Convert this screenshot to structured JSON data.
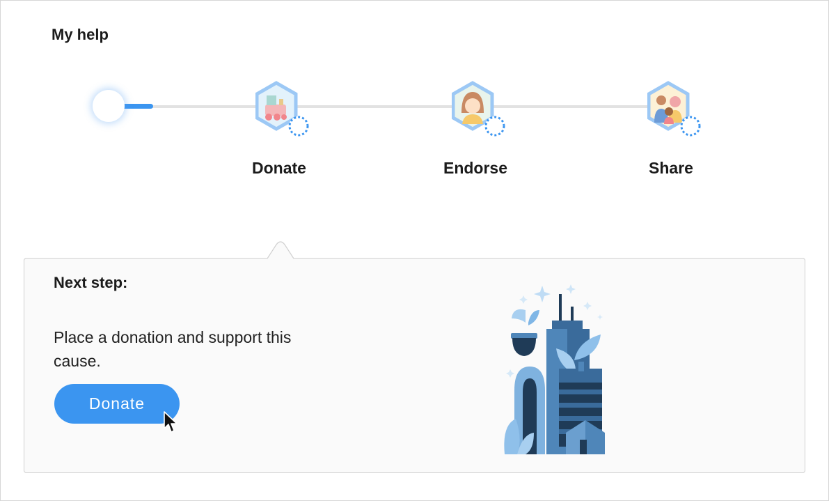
{
  "section": {
    "title": "My help"
  },
  "progress": {
    "current_step": 0,
    "total_steps": 3,
    "fill_fraction": 0.08
  },
  "steps": [
    {
      "label": "Donate",
      "icon": "toy-train-icon",
      "status": "pending"
    },
    {
      "label": "Endorse",
      "icon": "girl-portrait-icon",
      "status": "pending"
    },
    {
      "label": "Share",
      "icon": "family-portrait-icon",
      "status": "pending"
    }
  ],
  "next_step": {
    "title": "Next step:",
    "description": "Place a donation and support this cause.",
    "button_label": "Donate"
  },
  "colors": {
    "accent": "#3b95f0",
    "badge_border": "#9cc8f5",
    "track": "#e2e2e2"
  }
}
